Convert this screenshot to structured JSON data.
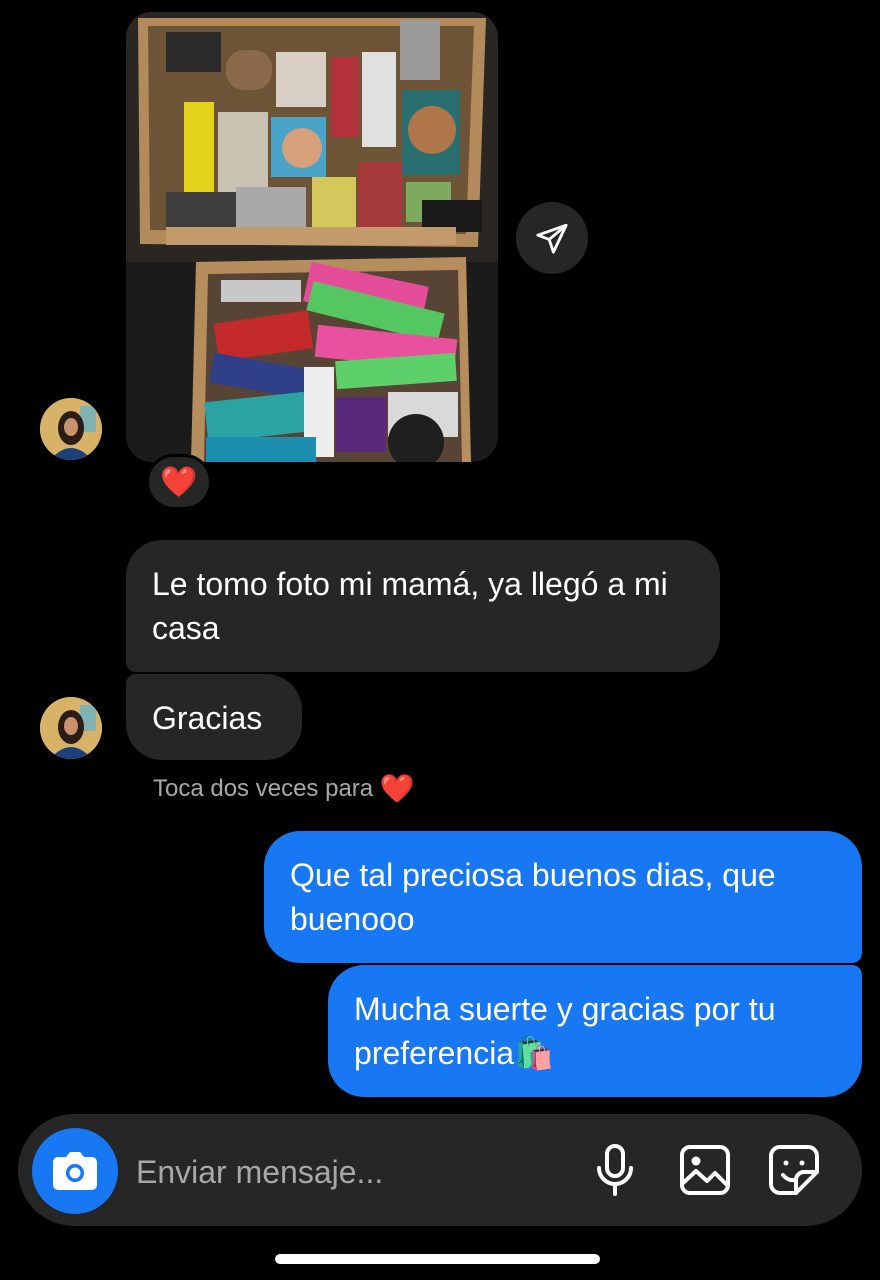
{
  "conversation": {
    "photo_message": {
      "image": "photo of two cardboard boxes full of makeup products",
      "reaction": "❤️"
    },
    "messages": [
      {
        "from": "them",
        "text": "Le tomo foto mi mamá, ya llegó a mi casa"
      },
      {
        "from": "them",
        "text": "Gracias"
      },
      {
        "from": "me",
        "text": "Que tal preciosa buenos dias, que buenooo"
      },
      {
        "from": "me",
        "text": "Mucha suerte y gracias por tu preferencia🛍️"
      }
    ],
    "hint": {
      "text": "Toca dos veces para",
      "heart": "❤️"
    }
  },
  "composer": {
    "placeholder": "Enviar mensaje...",
    "icons": [
      "camera-icon",
      "microphone-icon",
      "gallery-icon",
      "sticker-icon"
    ]
  },
  "colors": {
    "background": "#000000",
    "incoming_bubble": "#262626",
    "outgoing_bubble": "#1877f2",
    "heart": "#ed1e34"
  }
}
